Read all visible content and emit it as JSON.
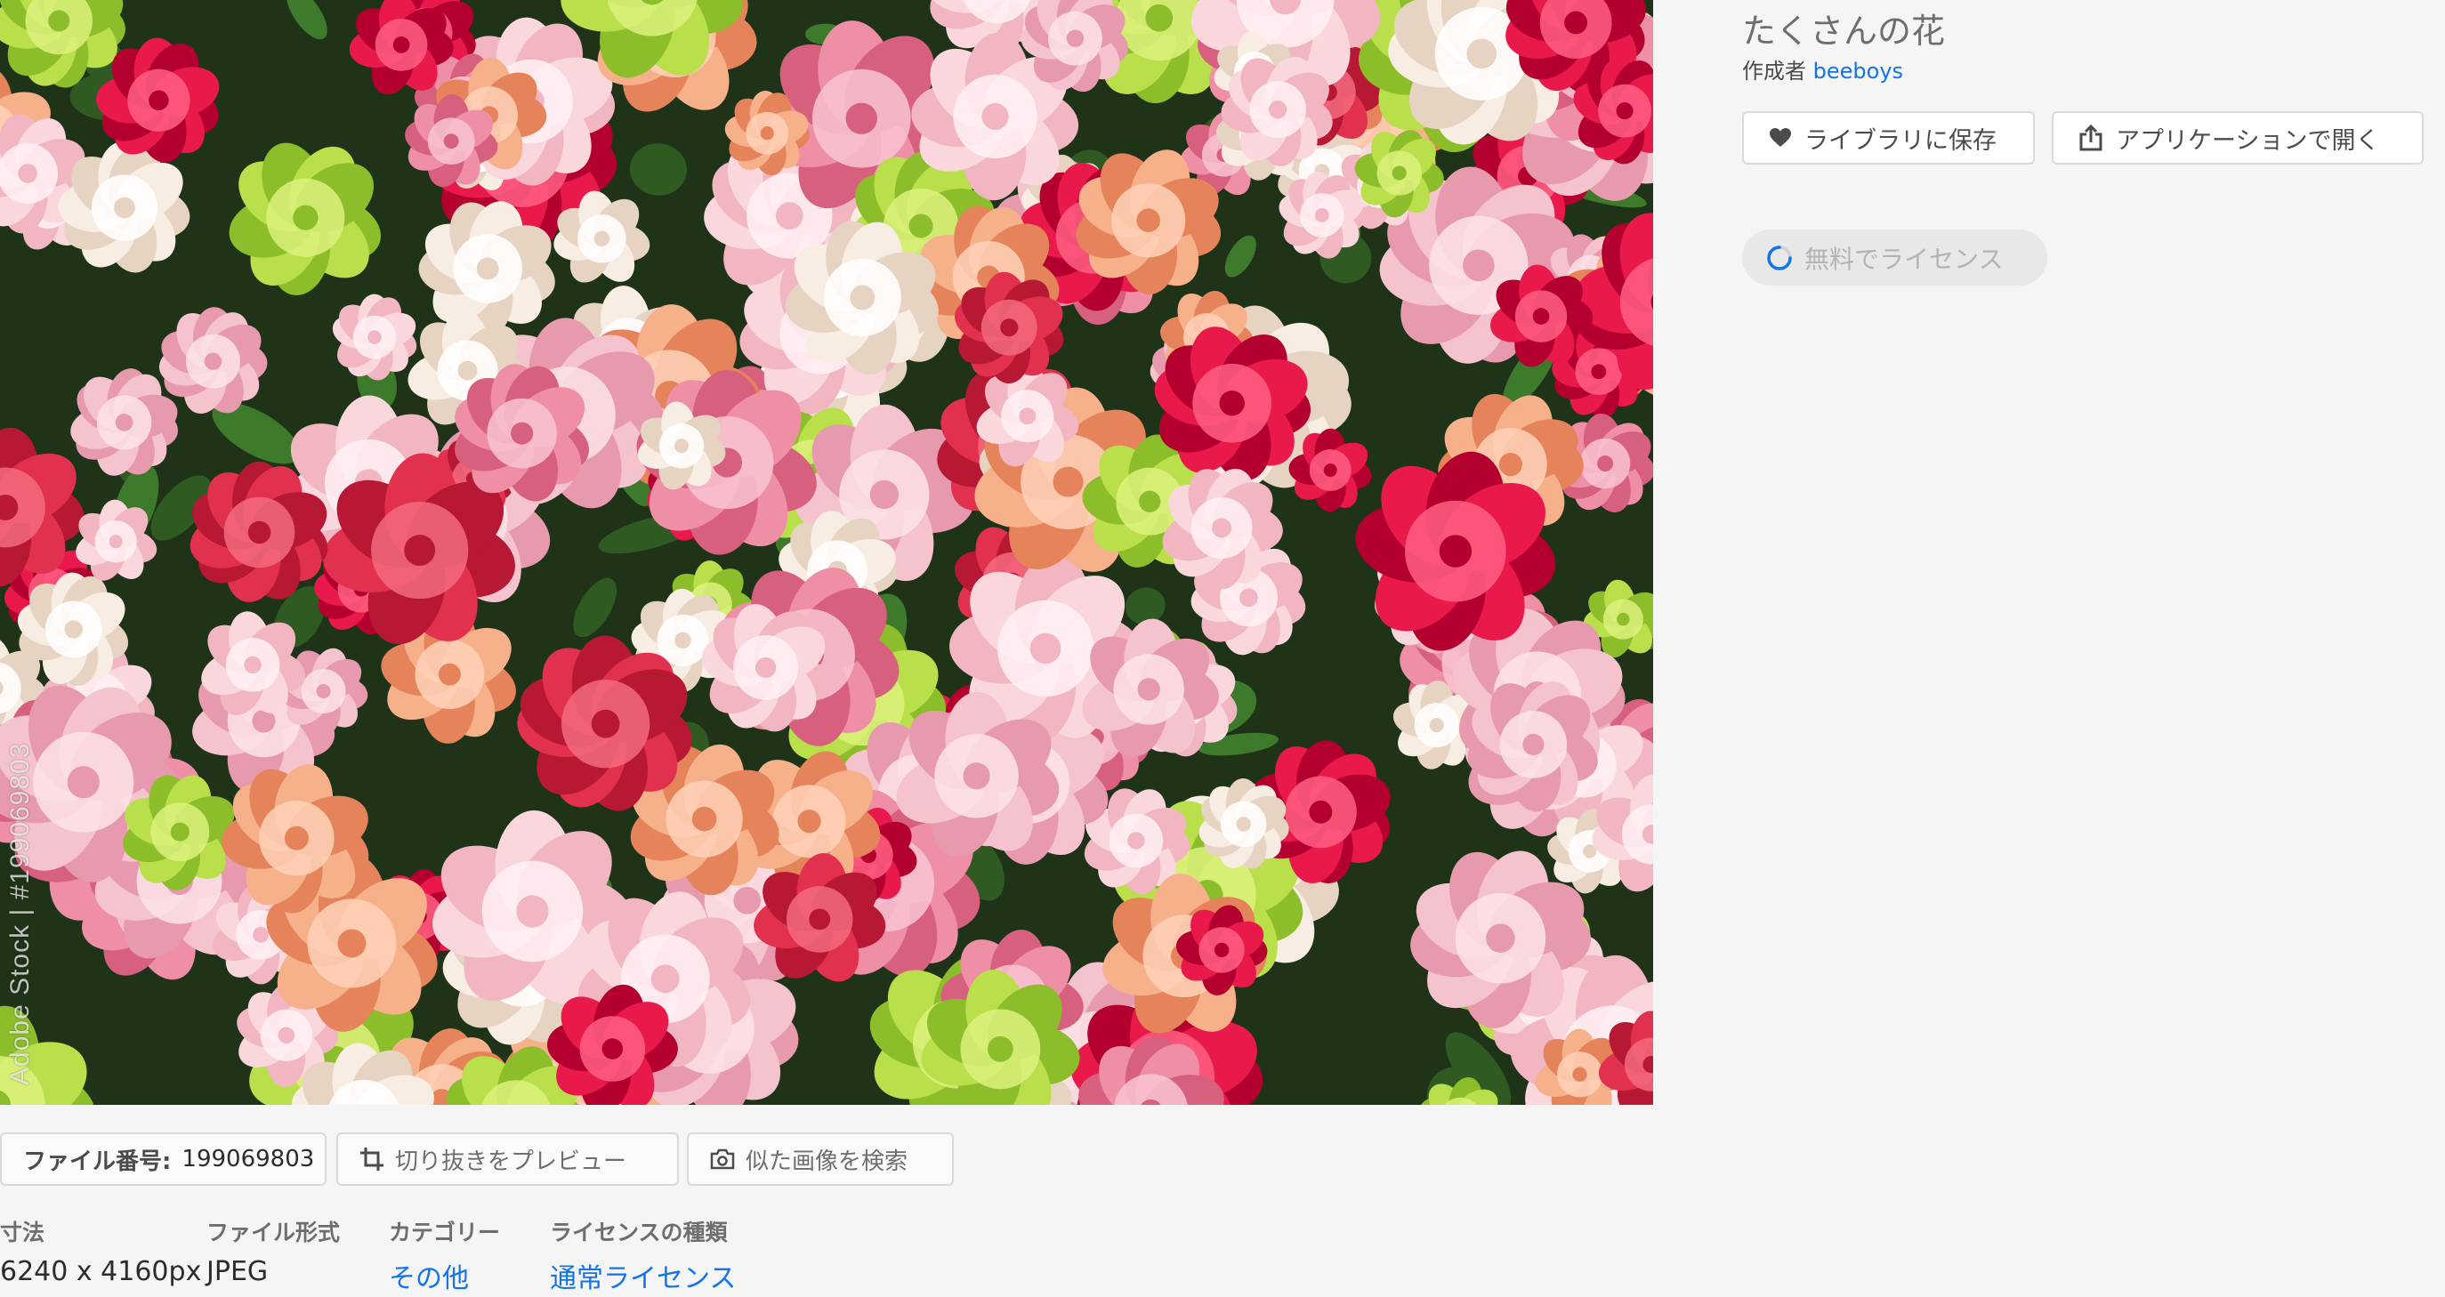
{
  "image": {
    "alt": "たくさんの花",
    "watermark": "Adobe Stock | #199069803"
  },
  "panel": {
    "title": "たくさんの花",
    "author_prefix": "作成者",
    "author_name": "beeboys",
    "save_label": "ライブラリに保存",
    "open_label": "アプリケーションで開く",
    "license_label": "無料でライセンス"
  },
  "toolbar": {
    "file_id_label": "ファイル番号:",
    "file_id": "199069803",
    "crop_label": "切り抜きをプレビュー",
    "similar_label": "似た画像を検索"
  },
  "meta": {
    "dimensions_label": "寸法",
    "dimensions": "6240 x 4160px",
    "format_label": "ファイル形式",
    "format": "JPEG",
    "category_label": "カテゴリー",
    "category": "その他",
    "license_type_label": "ライセンスの種類",
    "license_type": "通常ライセンス"
  },
  "colors": {
    "link": "#1473e6",
    "button_border": "#d9d9d9",
    "spinner": "#1473e6"
  },
  "icons": [
    "heart-icon",
    "share-icon",
    "spinner-icon",
    "crop-icon",
    "camera-icon"
  ]
}
